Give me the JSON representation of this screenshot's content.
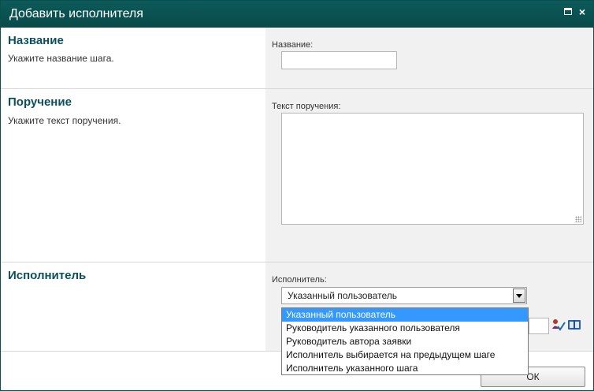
{
  "window": {
    "title": "Добавить исполнителя",
    "maximize_icon": "maximize-icon",
    "close_icon": "close-icon",
    "close_glyph": "×"
  },
  "sections": {
    "name": {
      "title": "Название",
      "description": "Укажите название шага.",
      "field_label": "Название:",
      "value": ""
    },
    "task": {
      "title": "Поручение",
      "description": "Укажите текст поручения.",
      "field_label": "Текст поручения:",
      "value": ""
    },
    "executor": {
      "title": "Исполнитель",
      "field_label": "Исполнитель:",
      "selected": "Указанный пользователь",
      "options": [
        "Указанный пользователь",
        "Руководитель указанного пользователя",
        "Руководитель автора заявки",
        "Исполнитель выбирается на предыдущем шаге",
        "Исполнитель указанного шага"
      ],
      "user_value": ""
    }
  },
  "footer": {
    "ok_label": "ОК"
  },
  "colors": {
    "titlebar": "#0a4a4a",
    "section_title": "#0b4f5c",
    "right_panel": "#f1f1f1",
    "dropdown_highlight": "#3399ff"
  }
}
